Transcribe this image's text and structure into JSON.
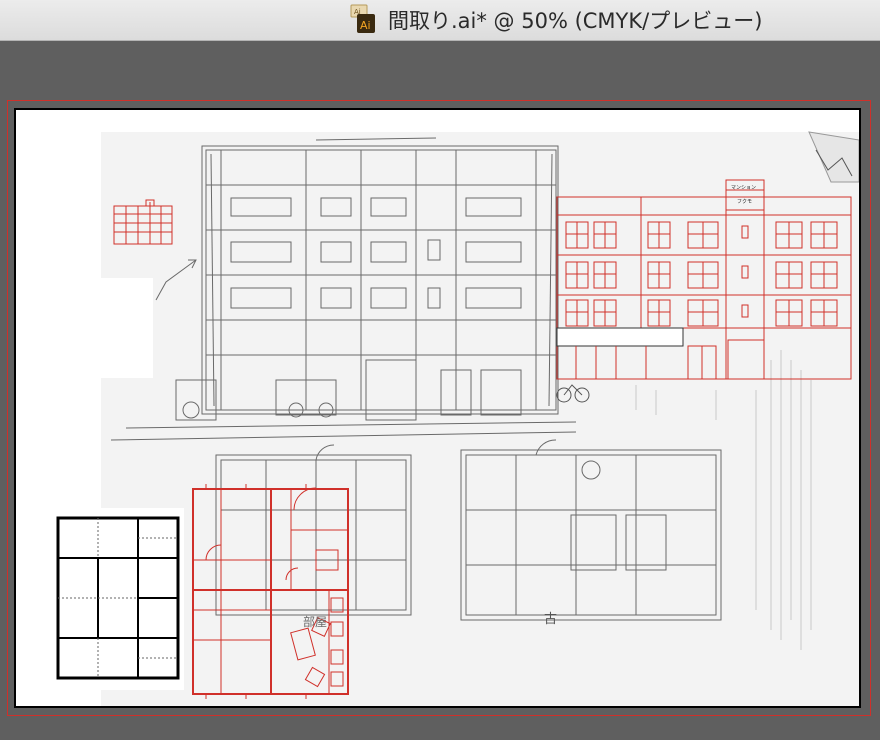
{
  "window": {
    "title": "間取り.ai* @ 50% (CMYK/プレビュー)",
    "doc_icon_label": "Ai",
    "doc_icon_color": "#3a2a10",
    "doc_icon_text_color": "#f5a623"
  },
  "artboard": {
    "sign_line1": "マンション",
    "sign_line2": "フクモ",
    "room_label": "部屋",
    "room_label2": "古",
    "colors": {
      "accent": "#d0302a",
      "sketch": "#6a6a6a"
    }
  }
}
